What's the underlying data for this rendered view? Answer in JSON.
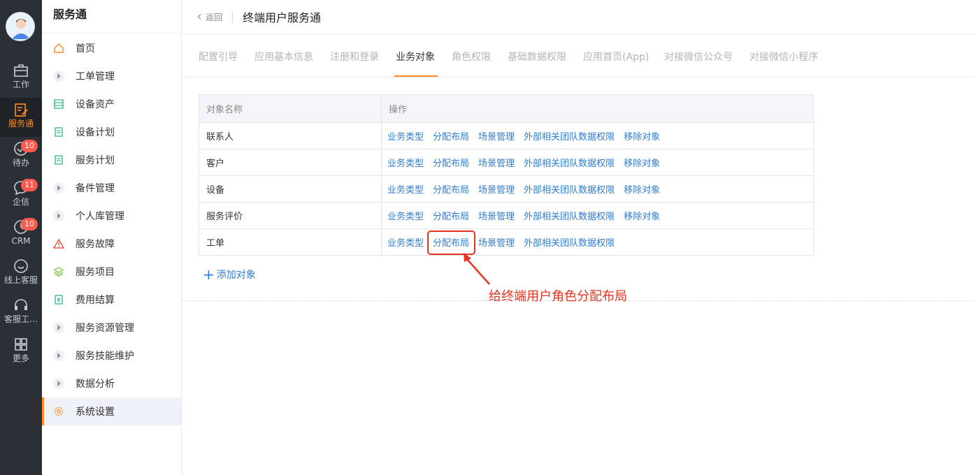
{
  "rail": {
    "items": [
      {
        "label": "工作",
        "icon": "briefcase-icon"
      },
      {
        "label": "服务通",
        "icon": "service-icon"
      },
      {
        "label": "待办",
        "icon": "check-circle-icon",
        "badge": "10"
      },
      {
        "label": "企信",
        "icon": "chat-bubble-icon",
        "badge": "11"
      },
      {
        "label": "CRM",
        "icon": "clock-icon",
        "badge": "10"
      },
      {
        "label": "线上客服",
        "icon": "smile-chat-icon"
      },
      {
        "label": "客服工…",
        "icon": "headset-icon"
      },
      {
        "label": "更多",
        "icon": "grid-icon"
      }
    ],
    "active_color": "#ff8a1f"
  },
  "sidebar": {
    "title": "服务通",
    "items": [
      {
        "label": "首页",
        "icon": "home-icon"
      },
      {
        "label": "工单管理",
        "icon": "caret-right-icon"
      },
      {
        "label": "设备资产",
        "icon": "device-icon"
      },
      {
        "label": "设备计划",
        "icon": "document-icon"
      },
      {
        "label": "服务计划",
        "icon": "document-icon"
      },
      {
        "label": "备件管理",
        "icon": "caret-right-icon"
      },
      {
        "label": "个人库管理",
        "icon": "caret-right-icon"
      },
      {
        "label": "服务故障",
        "icon": "warning-icon"
      },
      {
        "label": "服务项目",
        "icon": "layers-icon"
      },
      {
        "label": "费用结算",
        "icon": "yuan-doc-icon"
      },
      {
        "label": "服务资源管理",
        "icon": "caret-right-icon"
      },
      {
        "label": "服务技能维护",
        "icon": "caret-right-icon"
      },
      {
        "label": "数据分析",
        "icon": "caret-right-icon"
      },
      {
        "label": "系统设置",
        "icon": "gear-icon",
        "active": true
      }
    ]
  },
  "header": {
    "back_label": "返回",
    "title": "终端用户服务通"
  },
  "tabs": [
    {
      "label": "配置引导"
    },
    {
      "label": "应用基本信息"
    },
    {
      "label": "注册和登录"
    },
    {
      "label": "业务对象",
      "active": true
    },
    {
      "label": "角色权限"
    },
    {
      "label": "基础数据权限"
    },
    {
      "label": "应用首页(App)"
    },
    {
      "label": "对接微信公众号"
    },
    {
      "label": "对接微信小程序"
    }
  ],
  "table": {
    "headers": [
      "对象名称",
      "操作"
    ],
    "rows": [
      {
        "name": "联系人",
        "ops": [
          "业务类型",
          "分配布局",
          "场景管理",
          "外部相关团队数据权限",
          "移除对象"
        ]
      },
      {
        "name": "客户",
        "ops": [
          "业务类型",
          "分配布局",
          "场景管理",
          "外部相关团队数据权限",
          "移除对象"
        ]
      },
      {
        "name": "设备",
        "ops": [
          "业务类型",
          "分配布局",
          "场景管理",
          "外部相关团队数据权限",
          "移除对象"
        ]
      },
      {
        "name": "服务评价",
        "ops": [
          "业务类型",
          "分配布局",
          "场景管理",
          "外部相关团队数据权限",
          "移除对象"
        ]
      },
      {
        "name": "工单",
        "ops": [
          "业务类型",
          "分配布局",
          "场景管理",
          "外部相关团队数据权限"
        ]
      }
    ]
  },
  "add_object_label": "添加对象",
  "annotation": {
    "text": "给终端用户角色分配布局",
    "color": "#e8321e"
  },
  "colors": {
    "link": "#2f7dd1",
    "accent": "#ff8a1f"
  }
}
